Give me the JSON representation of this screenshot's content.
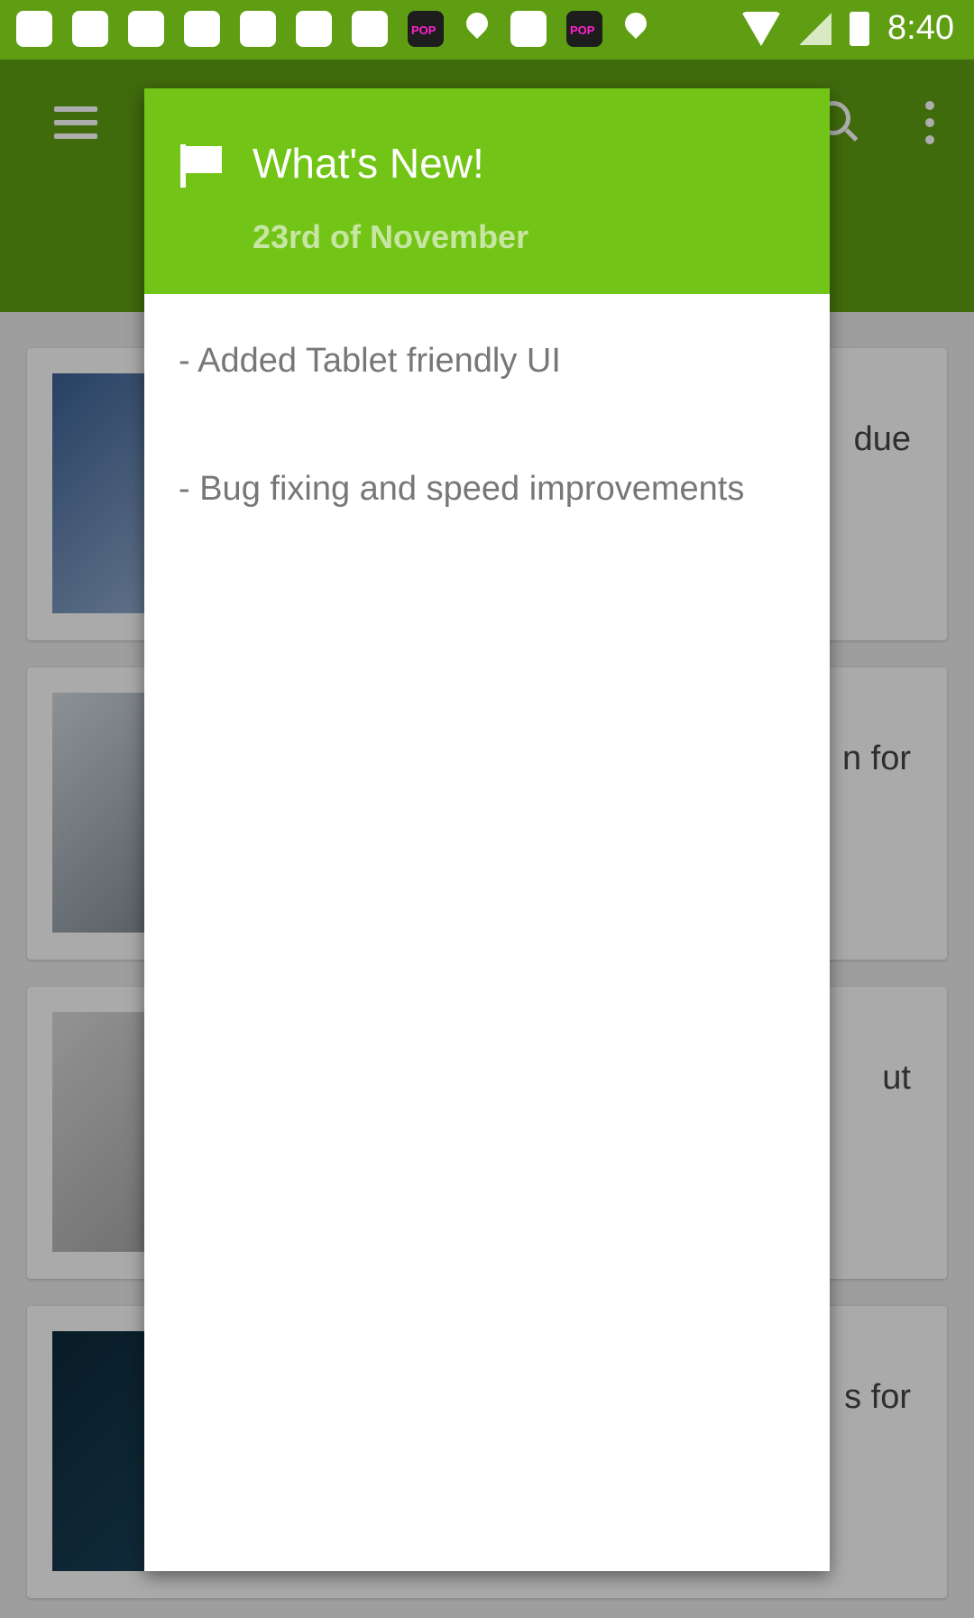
{
  "status_bar": {
    "time": "8:40"
  },
  "background_cards": [
    {
      "snippet": "due"
    },
    {
      "snippet": "n for"
    },
    {
      "snippet": "ut"
    },
    {
      "snippet": "s for"
    }
  ],
  "dialog": {
    "title": "What's New!",
    "date": "23rd of November",
    "changes": [
      "- Added Tablet friendly UI",
      "- Bug fixing and speed improvements"
    ]
  },
  "colors": {
    "app_bar": "#5f9e13",
    "dialog_header": "#72c516",
    "dialog_date": "#c8e6a3"
  }
}
